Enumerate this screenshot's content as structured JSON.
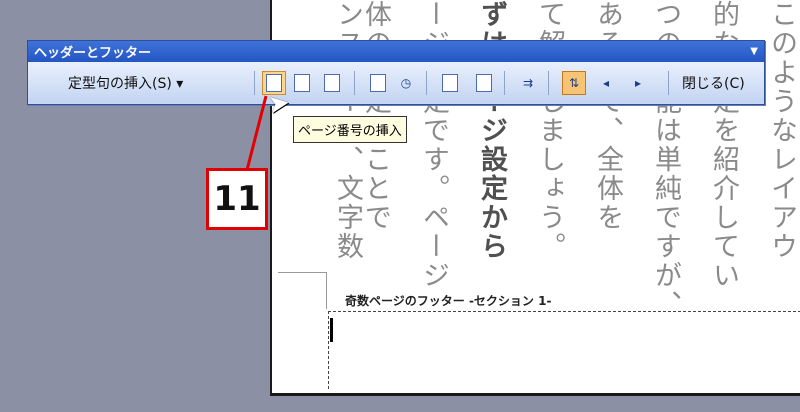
{
  "document": {
    "columns": [
      "このようなレイアウ",
      "的な設定を紹介してい",
      "つの機能は単純ですが、",
      "あるので、全体を",
      "て解説しましょう。",
      "ずはページ設定から",
      "ージ設定です。ページ",
      "体の設定のことで",
      "ンスペース、文字数"
    ],
    "footer_label": "奇数ページのフッター -セクション 1-"
  },
  "toolbar": {
    "title": "ヘッダーとフッター",
    "title_menu_icon": "dropdown-arrow-icon",
    "insert_autotext_label": "定型句の挿入(S)",
    "insert_autotext_arrow": "▾",
    "buttons": [
      {
        "name": "insert-page-number-icon",
        "glyph": "#"
      },
      {
        "name": "insert-page-count-icon",
        "glyph": "+"
      },
      {
        "name": "format-page-number-icon",
        "glyph": "¶"
      },
      {
        "name": "insert-date-icon",
        "glyph": "▦"
      },
      {
        "name": "insert-time-icon",
        "glyph": "◷"
      },
      {
        "name": "page-setup-icon",
        "glyph": "▭"
      },
      {
        "name": "show-hide-document-text-icon",
        "glyph": "▤"
      },
      {
        "name": "same-as-previous-icon",
        "glyph": "⇉"
      },
      {
        "name": "switch-header-footer-icon",
        "glyph": "⇅"
      },
      {
        "name": "show-previous-icon",
        "glyph": "◂"
      },
      {
        "name": "show-next-icon",
        "glyph": "▸"
      }
    ],
    "close_label": "閉じる(C)"
  },
  "tooltip": {
    "text": "ページ番号の挿入"
  },
  "callout": {
    "number": "11",
    "color": "#e20000"
  }
}
